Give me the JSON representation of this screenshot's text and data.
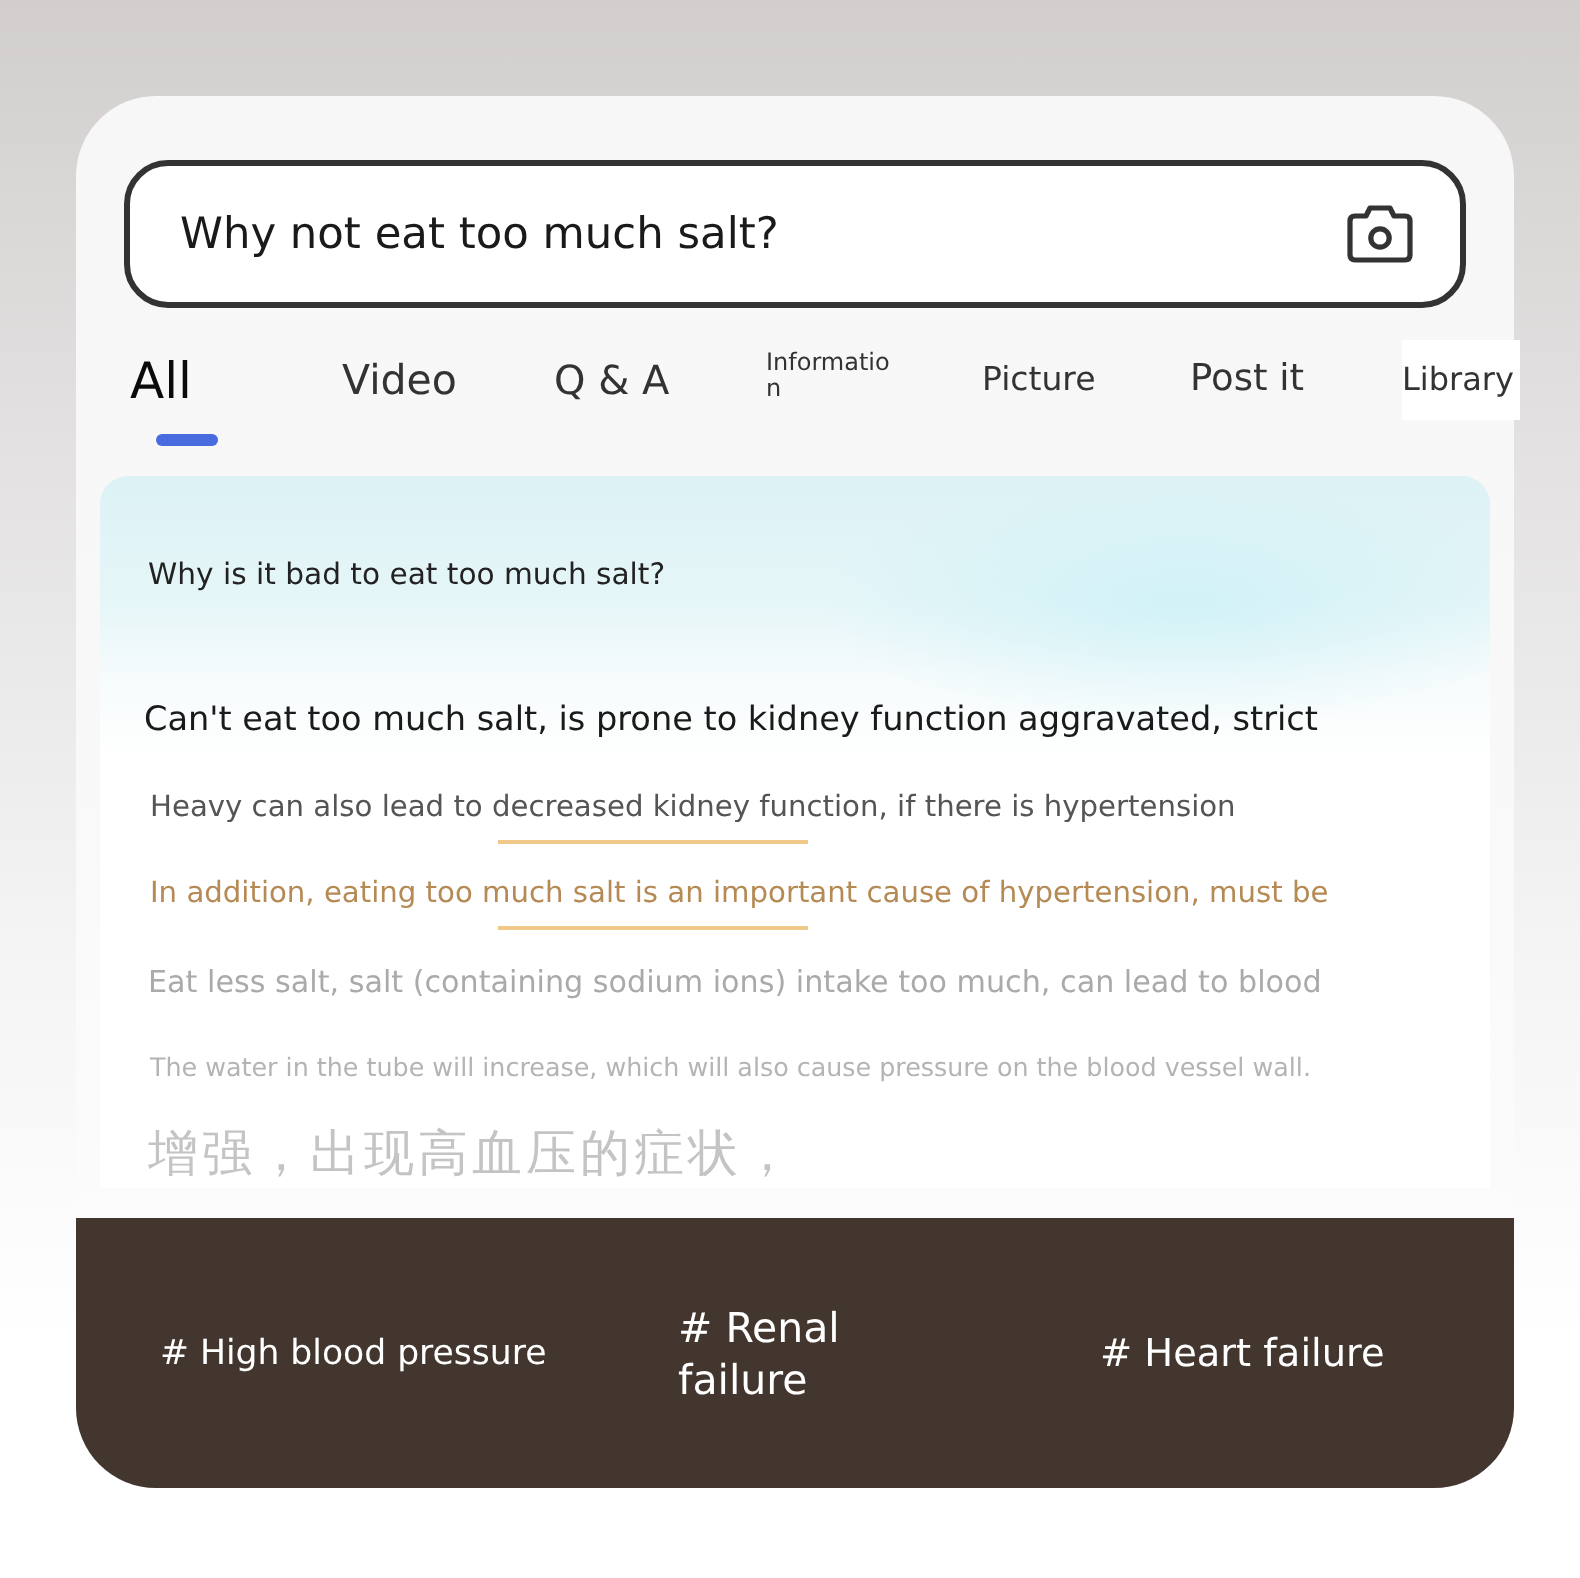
{
  "search": {
    "value": "Why not eat too much salt?"
  },
  "tabs": [
    {
      "label": "All",
      "selected": true
    },
    {
      "label": "Video",
      "selected": false
    },
    {
      "label": "Q & A",
      "selected": false
    },
    {
      "label": "Information",
      "selected": false
    },
    {
      "label": "Picture",
      "selected": false
    },
    {
      "label": "Post it",
      "selected": false
    },
    {
      "label": "Library",
      "selected": false
    }
  ],
  "answer": {
    "question": "Why is it bad to eat too much salt?",
    "lines": [
      {
        "kind": "lead",
        "text": "Can't eat too much salt, is prone to kidney function aggravated, strict",
        "underlined": false
      },
      {
        "kind": "body",
        "text": "Heavy can also lead to decreased kidney function, if there is hypertension",
        "underlined": true
      },
      {
        "kind": "accent",
        "text": "In addition, eating too much salt is an important cause of hypertension, must be",
        "underlined": true
      },
      {
        "kind": "faded",
        "text": "Eat less salt, salt (containing sodium ions) intake too much, can lead to blood",
        "underlined": false
      },
      {
        "kind": "faint",
        "text": "The water in the tube will increase, which will also cause pressure on the blood vessel wall.",
        "underlined": false
      },
      {
        "kind": "ghost",
        "text": "增强，出现高血压的症状，",
        "underlined": false
      }
    ]
  },
  "tags": [
    "# High blood pressure",
    "# Renal failure",
    "# Heart failure"
  ]
}
